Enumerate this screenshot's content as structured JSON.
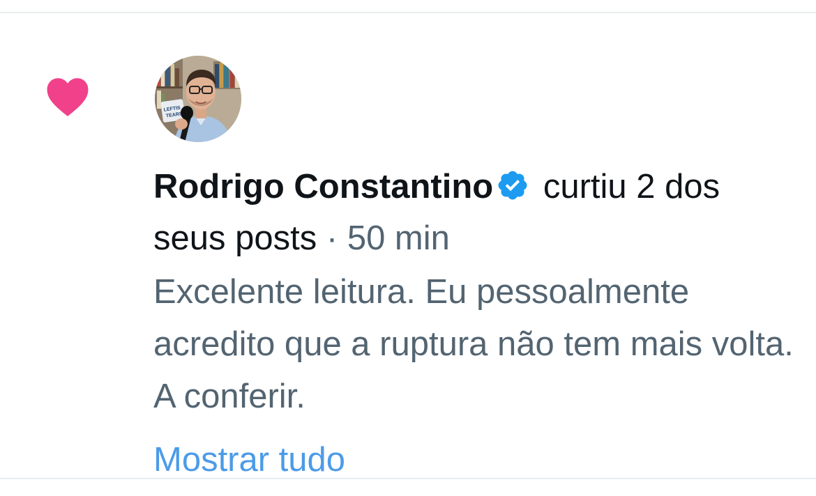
{
  "notification": {
    "author_name": "Rodrigo Constantino",
    "action_text": "curtiu 2 dos seus posts",
    "separator": "·",
    "time": "50 min",
    "snippet": "Excelente leitura. Eu pessoalmente acredito que a ruptura não tem mais volta. A conferir.",
    "show_more_label": "Mostrar tudo",
    "icons": {
      "like": "heart-icon",
      "verified": "verified-badge-icon"
    },
    "mug_text": "LEFTIS TEARS"
  },
  "colors": {
    "heart": "#f0418a",
    "verified": "#1d9bf0",
    "link": "#4c9be8",
    "secondary_text": "#536471",
    "primary_text": "#0f1419",
    "divider": "#e9ecef"
  }
}
